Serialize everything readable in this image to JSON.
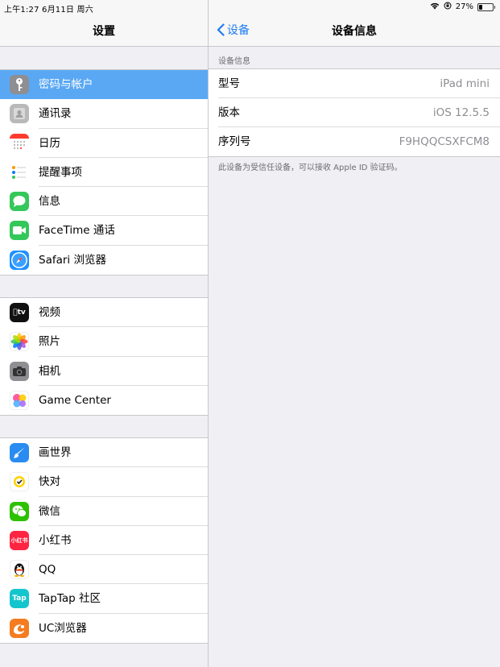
{
  "status_bar": {
    "time_date": "上午1:27  6月11日 周六",
    "battery": "27%",
    "battery_level": 0.27
  },
  "left_pane": {
    "title": "设置",
    "groups": [
      [
        {
          "label": "密码与帐户",
          "icon": "key-icon",
          "color": "#8e8e93",
          "selected": true
        },
        {
          "label": "通讯录",
          "icon": "contacts-icon",
          "color": "#b9b9b9"
        },
        {
          "label": "日历",
          "icon": "calendar-icon",
          "color": "#ffffff"
        },
        {
          "label": "提醒事项",
          "icon": "reminders-icon",
          "color": "#ffffff"
        },
        {
          "label": "信息",
          "icon": "messages-icon",
          "color": "#34c759"
        },
        {
          "label": "FaceTime 通话",
          "icon": "facetime-icon",
          "color": "#34c759"
        },
        {
          "label": "Safari 浏览器",
          "icon": "safari-icon",
          "color": "#1e90ff"
        }
      ],
      [
        {
          "label": "视频",
          "icon": "tv-icon",
          "color": "#111111"
        },
        {
          "label": "照片",
          "icon": "photos-icon",
          "color": "#ffffff"
        },
        {
          "label": "相机",
          "icon": "camera-icon",
          "color": "#8e8e93"
        },
        {
          "label": "Game Center",
          "icon": "game-center-icon",
          "color": "#ffffff"
        }
      ],
      [
        {
          "label": "画世界",
          "icon": "brush-icon",
          "color": "#2a8cf0"
        },
        {
          "label": "快对",
          "icon": "kuaidui-icon",
          "color": "#ffffff"
        },
        {
          "label": "微信",
          "icon": "wechat-icon",
          "color": "#2dc100"
        },
        {
          "label": "小红书",
          "icon": "xiaohongshu-icon",
          "color": "#ff2442"
        },
        {
          "label": "QQ",
          "icon": "qq-penguin-icon",
          "color": "#ffffff"
        },
        {
          "label": "TapTap 社区",
          "icon": "taptap-icon",
          "color": "#15c5ce"
        },
        {
          "label": "UC浏览器",
          "icon": "uc-browser-icon",
          "color": "#f57c20"
        }
      ]
    ]
  },
  "icon_glyphs": {
    "xiaohongshu": "小红书",
    "taptap": "Tap"
  },
  "right_pane": {
    "back_label": "设备",
    "title": "设备信息",
    "section_header": "设备信息",
    "rows": [
      {
        "key": "型号",
        "value": "iPad mini"
      },
      {
        "key": "版本",
        "value": "iOS 12.5.5"
      },
      {
        "key": "序列号",
        "value": "F9HQQCSXFCM8"
      }
    ],
    "footer_note": "此设备为受信任设备，可以接收 Apple ID 验证码。"
  }
}
